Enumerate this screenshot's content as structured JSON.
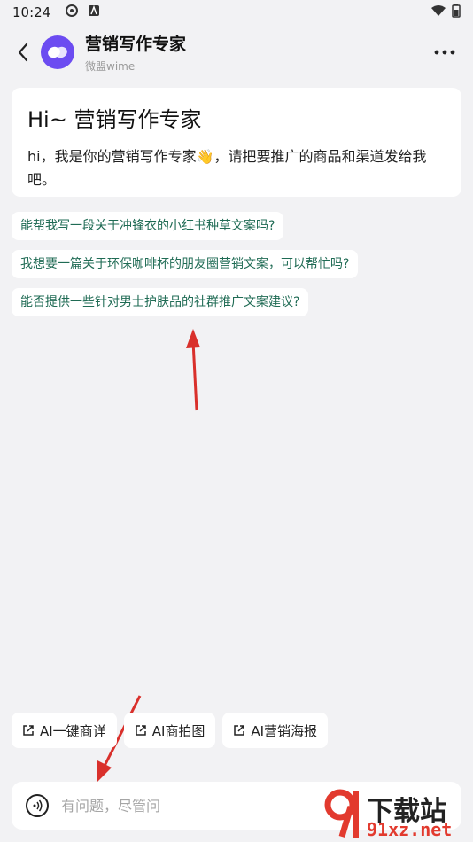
{
  "status": {
    "time": "10:24"
  },
  "header": {
    "title": "营销写作专家",
    "subtitle": "微盟wime"
  },
  "greeting": {
    "title": "Hi~ 营销写作专家",
    "text": "hi，我是你的营销写作专家👋，请把要推广的商品和渠道发给我吧。"
  },
  "suggestions": [
    "能帮我写一段关于冲锋衣的小红书种草文案吗?",
    "我想要一篇关于环保咖啡杯的朋友圈营销文案，可以帮忙吗?",
    "能否提供一些针对男士护肤品的社群推广文案建议?"
  ],
  "actions": [
    "AI一键商详",
    "AI商拍图",
    "AI营销海报"
  ],
  "input": {
    "placeholder": "有问题，尽管问"
  },
  "watermark": {
    "text": "下载站",
    "url": "91xz.net"
  },
  "colors": {
    "suggestion_text": "#1f6b54",
    "avatar": "#6c4cf1",
    "arrow": "#d9302b"
  }
}
